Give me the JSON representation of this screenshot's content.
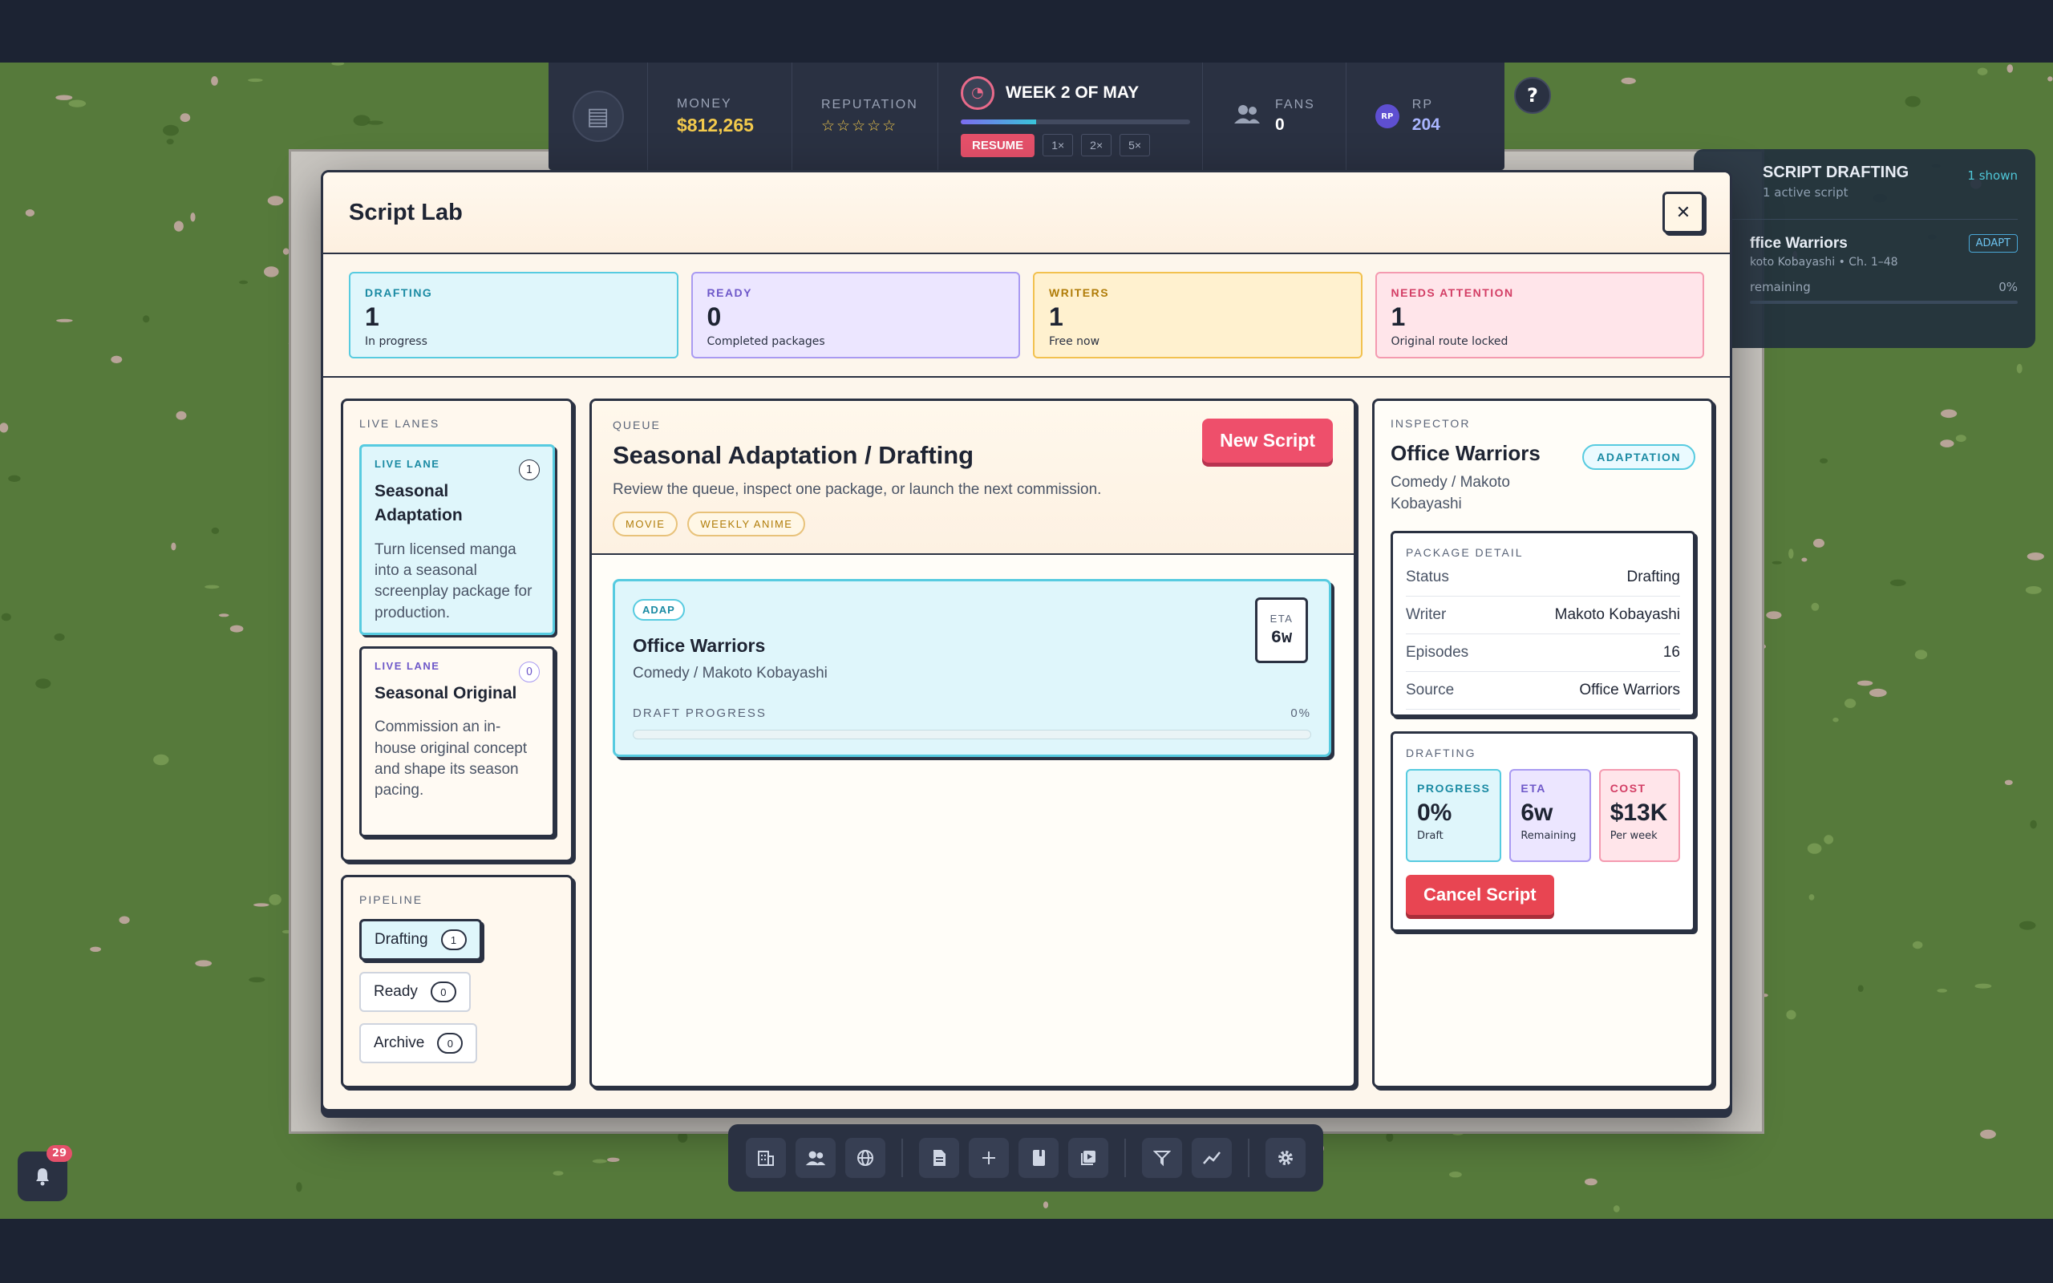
{
  "hud": {
    "money_label": "MONEY",
    "money_value": "$812,265",
    "reputation_label": "REPUTATION",
    "reputation_stars": "☆☆☆☆☆",
    "week_label": "WEEK 2 OF MAY",
    "week_progress": 0.33,
    "resume_label": "RESUME",
    "speeds": [
      "1×",
      "2×",
      "5×"
    ],
    "fans_label": "FANS",
    "fans_value": "0",
    "rp_badge": "RP",
    "rp_label": "RP",
    "rp_value": "204",
    "help_label": "?"
  },
  "side_panel": {
    "title": "SCRIPT DRAFTING",
    "subtitle": "1 active script",
    "count": "1 shown",
    "item_title": "ffice Warriors",
    "item_tag": "ADAPT",
    "item_meta": "koto Kobayashi • Ch. 1–48",
    "item_left": "remaining",
    "item_right": "0%"
  },
  "modal": {
    "title": "Script Lab",
    "close_label": "✕",
    "stats": [
      {
        "label": "DRAFTING",
        "value": "1",
        "sub": "In progress"
      },
      {
        "label": "READY",
        "value": "0",
        "sub": "Completed packages"
      },
      {
        "label": "WRITERS",
        "value": "1",
        "sub": "Free now"
      },
      {
        "label": "NEEDS ATTENTION",
        "value": "1",
        "sub": "Original route locked"
      }
    ],
    "lanes": {
      "label": "LIVE LANES",
      "items": [
        {
          "tag": "LIVE LANE",
          "count": "1",
          "title": "Seasonal Adaptation",
          "desc": "Turn licensed manga into a seasonal screenplay package for production."
        },
        {
          "tag": "LIVE LANE",
          "count": "0",
          "title": "Seasonal Original",
          "desc": "Commission an in-house original concept and shape its season pacing."
        }
      ]
    },
    "pipeline": {
      "label": "PIPELINE",
      "items": [
        {
          "label": "Drafting",
          "count": "1"
        },
        {
          "label": "Ready",
          "count": "0"
        },
        {
          "label": "Archive",
          "count": "0"
        }
      ]
    },
    "queue": {
      "label": "QUEUE",
      "title": "Seasonal Adaptation / Drafting",
      "desc": "Review the queue, inspect one package, or launch the next commission.",
      "chips": [
        "MOVIE",
        "WEEKLY ANIME"
      ],
      "new_button": "New Script",
      "card": {
        "tag": "ADAP",
        "title": "Office Warriors",
        "sub": "Comedy / Makoto Kobayashi",
        "eta_label": "ETA",
        "eta_value": "6w",
        "progress_label": "DRAFT PROGRESS",
        "progress_text": "0%",
        "progress_value": 0
      }
    },
    "inspector": {
      "label": "INSPECTOR",
      "title": "Office Warriors",
      "chip": "ADAPTATION",
      "sub": "Comedy / Makoto Kobayashi",
      "detail_label": "PACKAGE DETAIL",
      "details": [
        {
          "key": "Status",
          "value": "Drafting"
        },
        {
          "key": "Writer",
          "value": "Makoto Kobayashi"
        },
        {
          "key": "Episodes",
          "value": "16"
        },
        {
          "key": "Source",
          "value": "Office Warriors"
        }
      ],
      "drafting_label": "DRAFTING",
      "minis": [
        {
          "label": "PROGRESS",
          "value": "0%",
          "sub": "Draft"
        },
        {
          "label": "ETA",
          "value": "6w",
          "sub": "Remaining"
        },
        {
          "label": "COST",
          "value": "$13K",
          "sub": "Per week"
        }
      ],
      "cancel_button": "Cancel Script"
    }
  },
  "toolbar": {
    "icons": [
      "building-icon",
      "people-icon",
      "globe-icon",
      "document-icon",
      "plus-icon",
      "book-icon",
      "media-icon",
      "filter-icon",
      "chart-icon",
      "gear-icon"
    ]
  },
  "notifications": {
    "badge": "29"
  }
}
